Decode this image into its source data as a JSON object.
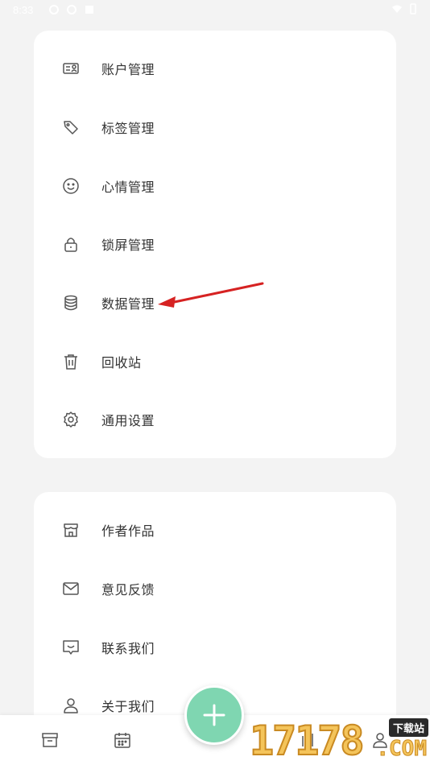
{
  "status_bar": {
    "time": "8:33"
  },
  "settings_card": {
    "items": [
      {
        "label": "账户管理",
        "icon": "account-card-icon"
      },
      {
        "label": "标签管理",
        "icon": "tag-icon"
      },
      {
        "label": "心情管理",
        "icon": "smiley-icon"
      },
      {
        "label": "锁屏管理",
        "icon": "lock-icon"
      },
      {
        "label": "数据管理",
        "icon": "database-icon"
      },
      {
        "label": "回收站",
        "icon": "trash-icon"
      },
      {
        "label": "通用设置",
        "icon": "gear-icon"
      }
    ]
  },
  "about_card": {
    "items": [
      {
        "label": "作者作品",
        "icon": "store-icon"
      },
      {
        "label": "意见反馈",
        "icon": "mail-icon"
      },
      {
        "label": "联系我们",
        "icon": "chat-smile-icon"
      },
      {
        "label": "关于我们",
        "icon": "person-icon"
      }
    ]
  },
  "bottom_nav": {
    "items": [
      "archive-icon",
      "calendar-icon",
      "add-icon",
      "chart-icon",
      "profile-icon"
    ]
  },
  "watermark": {
    "digits": "17178",
    "badge": "下载站",
    "com": ".COM"
  },
  "colors": {
    "fab": "#7fd6b1",
    "arrow": "#d62222",
    "background": "#f3f3f3"
  }
}
